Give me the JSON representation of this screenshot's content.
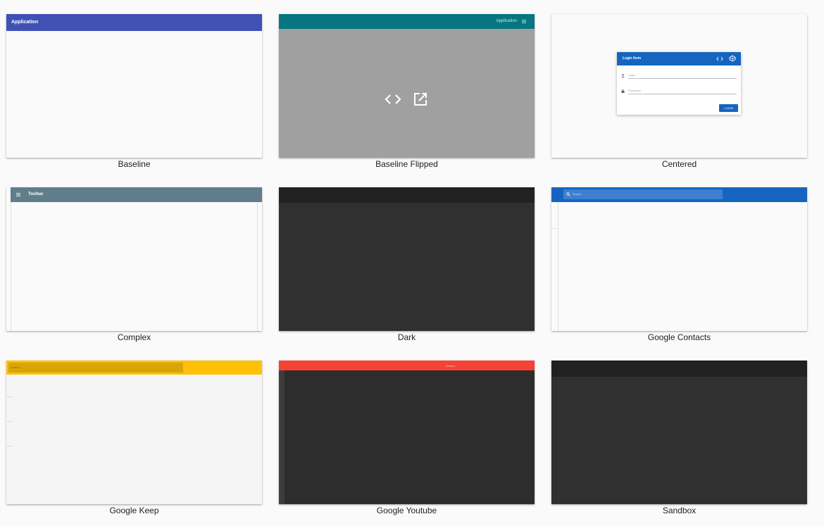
{
  "cards": [
    {
      "caption": "Baseline",
      "toolbar_title": "Application",
      "toolbar_color": "#3f51b5"
    },
    {
      "caption": "Baseline Flipped",
      "toolbar_title": "Application",
      "toolbar_color": "#067681",
      "overlay": {
        "view_code_icon": "code-icon",
        "open_icon": "open-in-new-icon"
      }
    },
    {
      "caption": "Centered",
      "login_form": {
        "title": "Login form",
        "login_placeholder": "Login",
        "password_placeholder": "Password",
        "button": "LOGIN"
      }
    },
    {
      "caption": "Complex",
      "toolbar_title": "Toolbar",
      "toolbar_color": "#607d8b"
    },
    {
      "caption": "Dark",
      "toolbar_color": "#212121"
    },
    {
      "caption": "Google Contacts",
      "search_placeholder": "Search",
      "toolbar_color": "#1565c0"
    },
    {
      "caption": "Google Keep",
      "search_placeholder": "Search",
      "toolbar_color": "#ffc107"
    },
    {
      "caption": "Google Youtube",
      "search_placeholder": "Search...",
      "toolbar_color": "#f44336"
    },
    {
      "caption": "Sandbox",
      "toolbar_color": "#212121"
    }
  ]
}
